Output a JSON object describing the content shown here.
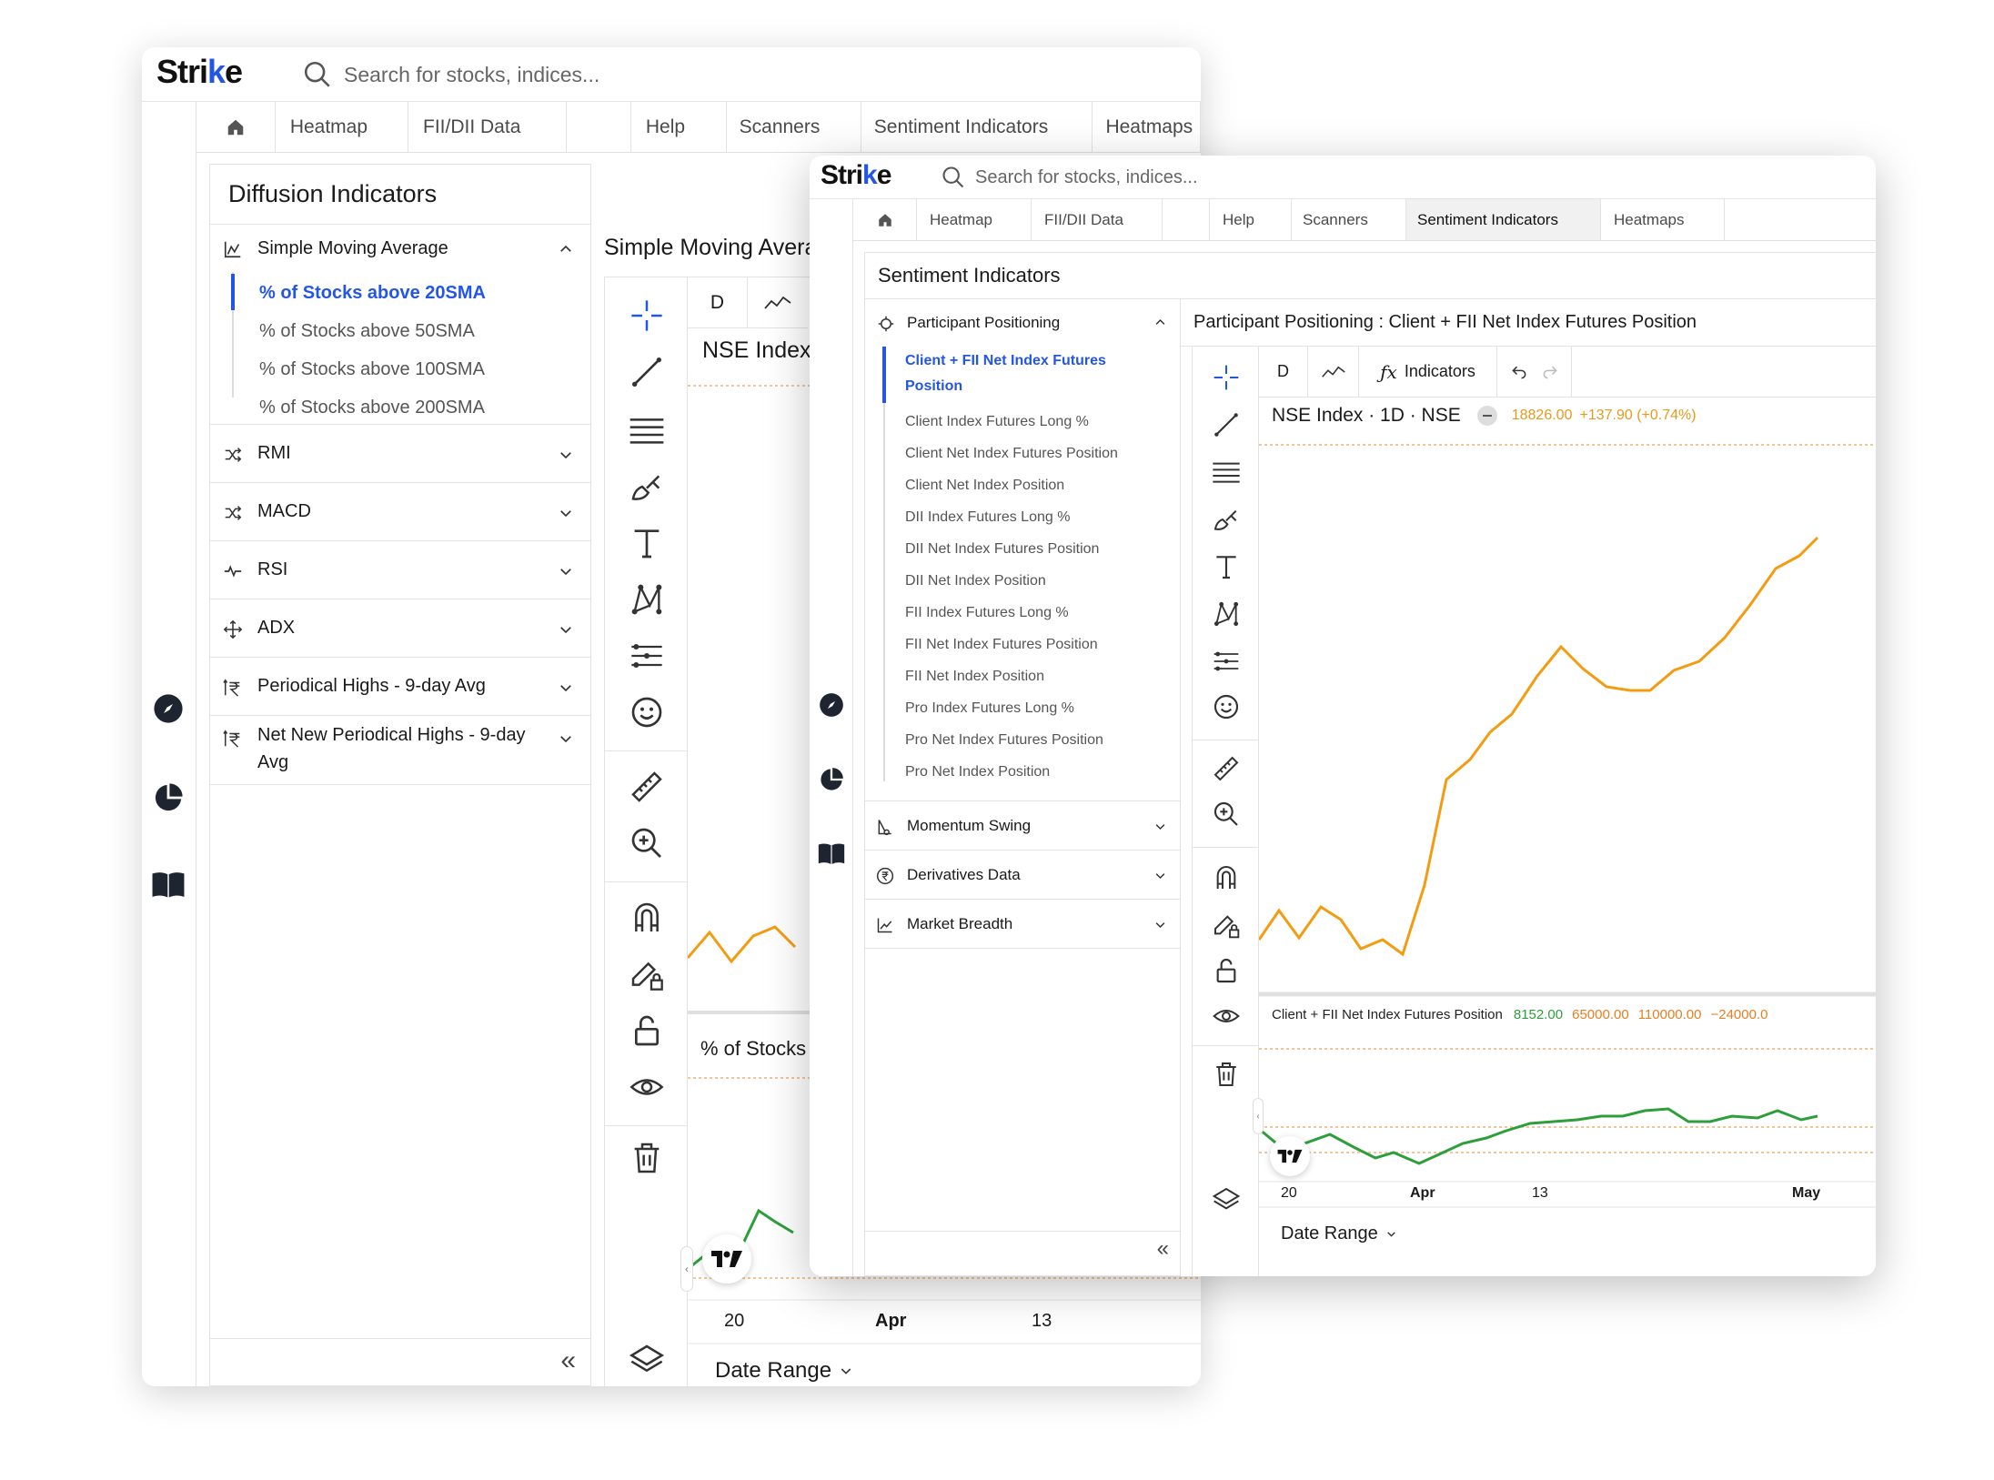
{
  "back_window": {
    "logo": {
      "text_main": "Stri",
      "text_k": "k",
      "text_end": "e"
    },
    "search": {
      "placeholder": "Search for stocks, indices..."
    },
    "nav": [
      "Heatmap",
      "FII/DII Data",
      "",
      "Help",
      "Scanners",
      "Sentiment Indicators",
      "Heatmaps"
    ],
    "panel_title": "Diffusion Indicators",
    "accordions": [
      {
        "label": "Simple Moving Average",
        "icon": "chart-area-icon",
        "expanded": true,
        "items": [
          "% of Stocks above 20SMA",
          "% of Stocks above 50SMA",
          "% of Stocks above 100SMA",
          "% of Stocks above 200SMA"
        ],
        "selected": 0
      },
      {
        "label": "RMI",
        "icon": "shuffle-icon"
      },
      {
        "label": "MACD",
        "icon": "shuffle-icon"
      },
      {
        "label": "RSI",
        "icon": "pulse-icon"
      },
      {
        "label": "ADX",
        "icon": "move-icon"
      },
      {
        "label": "Periodical Highs - 9-day Avg",
        "icon": "rupee-up-icon"
      },
      {
        "label": "Net New Periodical Highs - 9-day Avg",
        "icon": "rupee-up-icon"
      }
    ],
    "chart_title": "Simple Moving Avera",
    "interval": "D",
    "symbol": "NSE Index",
    "sub_label": "% of Stocks a",
    "x_labels": [
      "20",
      "Apr",
      "13"
    ],
    "date_range": "Date Range",
    "collapse": "«"
  },
  "front_window": {
    "logo": {
      "text_main": "Stri",
      "text_k": "k",
      "text_end": "e"
    },
    "search": {
      "placeholder": "Search for stocks, indices..."
    },
    "nav": [
      "Heatmap",
      "FII/DII Data",
      "",
      "Help",
      "Scanners",
      "Sentiment Indicators",
      "Heatmaps"
    ],
    "active_tab": "Sentiment Indicators",
    "panel_title": "Sentiment Indicators",
    "accordions": [
      {
        "label": "Participant Positioning",
        "icon": "target-icon",
        "expanded": true,
        "items": [
          "Client + FII Net Index Futures Position",
          "Client Index Futures Long %",
          "Client Net Index Futures Position",
          "Client Net Index Position",
          "DII Index Futures Long %",
          "DII Net Index Futures Position",
          "DII Net Index Position",
          "FII Index Futures Long %",
          "FII Net Index Futures Position",
          "FII Net Index Position",
          "Pro Index Futures Long %",
          "Pro Net Index Futures Position",
          "Pro Net Index Position"
        ],
        "selected": 0
      },
      {
        "label": "Momentum Swing",
        "icon": "swing-icon"
      },
      {
        "label": "Derivatives Data",
        "icon": "rupee-circle-icon"
      },
      {
        "label": "Market Breadth",
        "icon": "line-chart-icon"
      }
    ],
    "chart_title": "Participant Positioning : Client + FII Net Index Futures Position",
    "interval": "D",
    "indicators_label": "Indicators",
    "symbol": "NSE Index · 1D · NSE",
    "price": "18826.00",
    "change": "+137.90 (+0.74%)",
    "sub_label": "Client + FII Net Index Futures Position",
    "sub_values": [
      "8152.00",
      "65000.00",
      "110000.00",
      "−24000.0"
    ],
    "x_labels": [
      "20",
      "Apr",
      "13",
      "May"
    ],
    "date_range": "Date Range",
    "collapse": "«"
  },
  "colors": {
    "accent": "#2456e6",
    "orange": "#f39c12",
    "green": "#2e9e3a",
    "red_dotted": "#e67e22"
  }
}
